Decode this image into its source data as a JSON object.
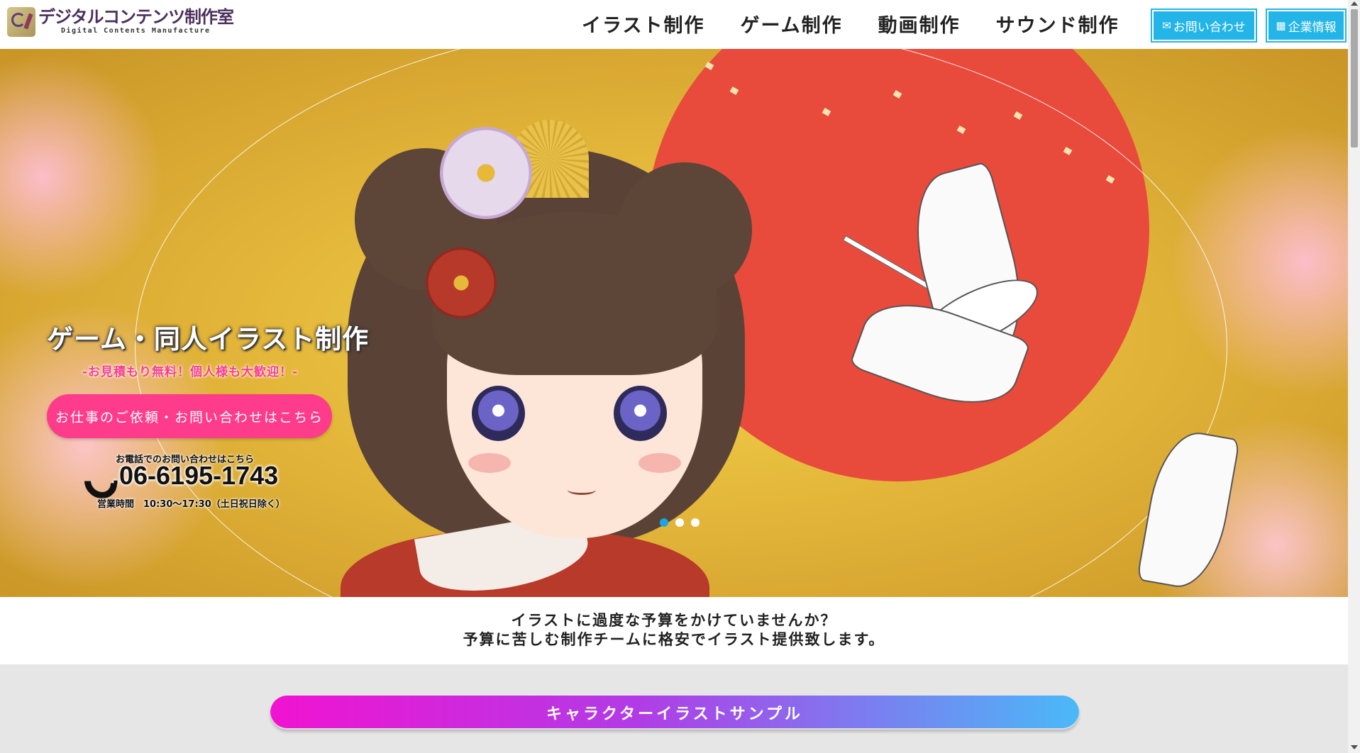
{
  "header": {
    "logo_title": "デジタルコンテンツ制作室",
    "logo_subtitle": "Digital Contents Manufacture",
    "nav": [
      {
        "label": "イラスト制作"
      },
      {
        "label": "ゲーム制作"
      },
      {
        "label": "動画制作"
      },
      {
        "label": "サウンド制作"
      }
    ],
    "contact_button": {
      "label": "お問い合わせ",
      "icon": "mail-icon"
    },
    "company_button": {
      "label": "企業情報",
      "icon": "building-icon"
    }
  },
  "hero": {
    "title": "ゲーム・同人イラスト制作",
    "subtitle": "-お見積もり無料！個人様も大歓迎！-",
    "cta_label": "お仕事のご依頼・お問い合わせはこちら",
    "phone_note": "お電話でのお問い合わせはこちら",
    "phone_icon": "phone-icon",
    "phone_number": ".06-6195-1743",
    "hours": "営業時間　10:30〜17:30（土日祝日除く）",
    "slider": {
      "total": 3,
      "active": 1
    }
  },
  "tagline": {
    "line1": "イラストに過度な予算をかけていませんか？",
    "line2": "予算に苦しむ制作チームに格安でイラスト提供致します。"
  },
  "section": {
    "title": "キャラクターイラストサンプル"
  },
  "colors": {
    "accent_blue": "#24b5e8",
    "accent_pink": "#ff3b8b",
    "gradient_start": "#f113d1",
    "gradient_end": "#4ab9f8"
  }
}
